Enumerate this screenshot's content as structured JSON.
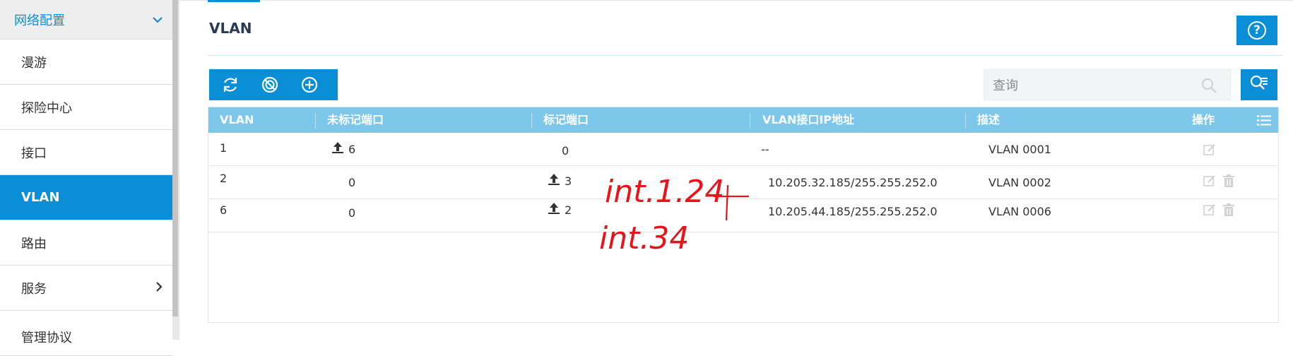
{
  "sidebar": {
    "group_label": "网络配置",
    "items": [
      {
        "label": "漫游"
      },
      {
        "label": "探险中心"
      },
      {
        "label": "接口"
      },
      {
        "label": "VLAN"
      },
      {
        "label": "路由"
      },
      {
        "label": "服务"
      },
      {
        "label": "管理协议"
      }
    ]
  },
  "page": {
    "title": "VLAN",
    "help_symbol": "?"
  },
  "search": {
    "placeholder": "查询"
  },
  "table": {
    "columns": [
      "VLAN",
      "未标记端口",
      "标记端口",
      "VLAN接口IP地址",
      "描述",
      "操作"
    ],
    "rows": [
      {
        "vlan": "1",
        "untagged": "6",
        "tagged": "0",
        "ip": "--",
        "desc": "VLAN 0001"
      },
      {
        "vlan": "2",
        "untagged": "0",
        "tagged": "3",
        "ip": "10.205.32.185/255.255.252.0",
        "desc": "VLAN 0002"
      },
      {
        "vlan": "6",
        "untagged": "0",
        "tagged": "2",
        "ip": "10.205.44.185/255.255.252.0",
        "desc": "VLAN 0006"
      }
    ]
  },
  "annotations": {
    "line1": "int.1.24",
    "line2": "int.34"
  },
  "colors": {
    "accent": "#0a8fd6",
    "header": "#7cc7ea",
    "annotation": "#e8141c"
  },
  "icons": [
    "chevron-down-icon",
    "chevron-right-icon",
    "refresh-icon",
    "disable-icon",
    "add-icon",
    "help-icon",
    "search-icon",
    "advanced-search-icon",
    "column-menu-icon",
    "upload-arrow-icon",
    "edit-icon",
    "delete-icon"
  ]
}
